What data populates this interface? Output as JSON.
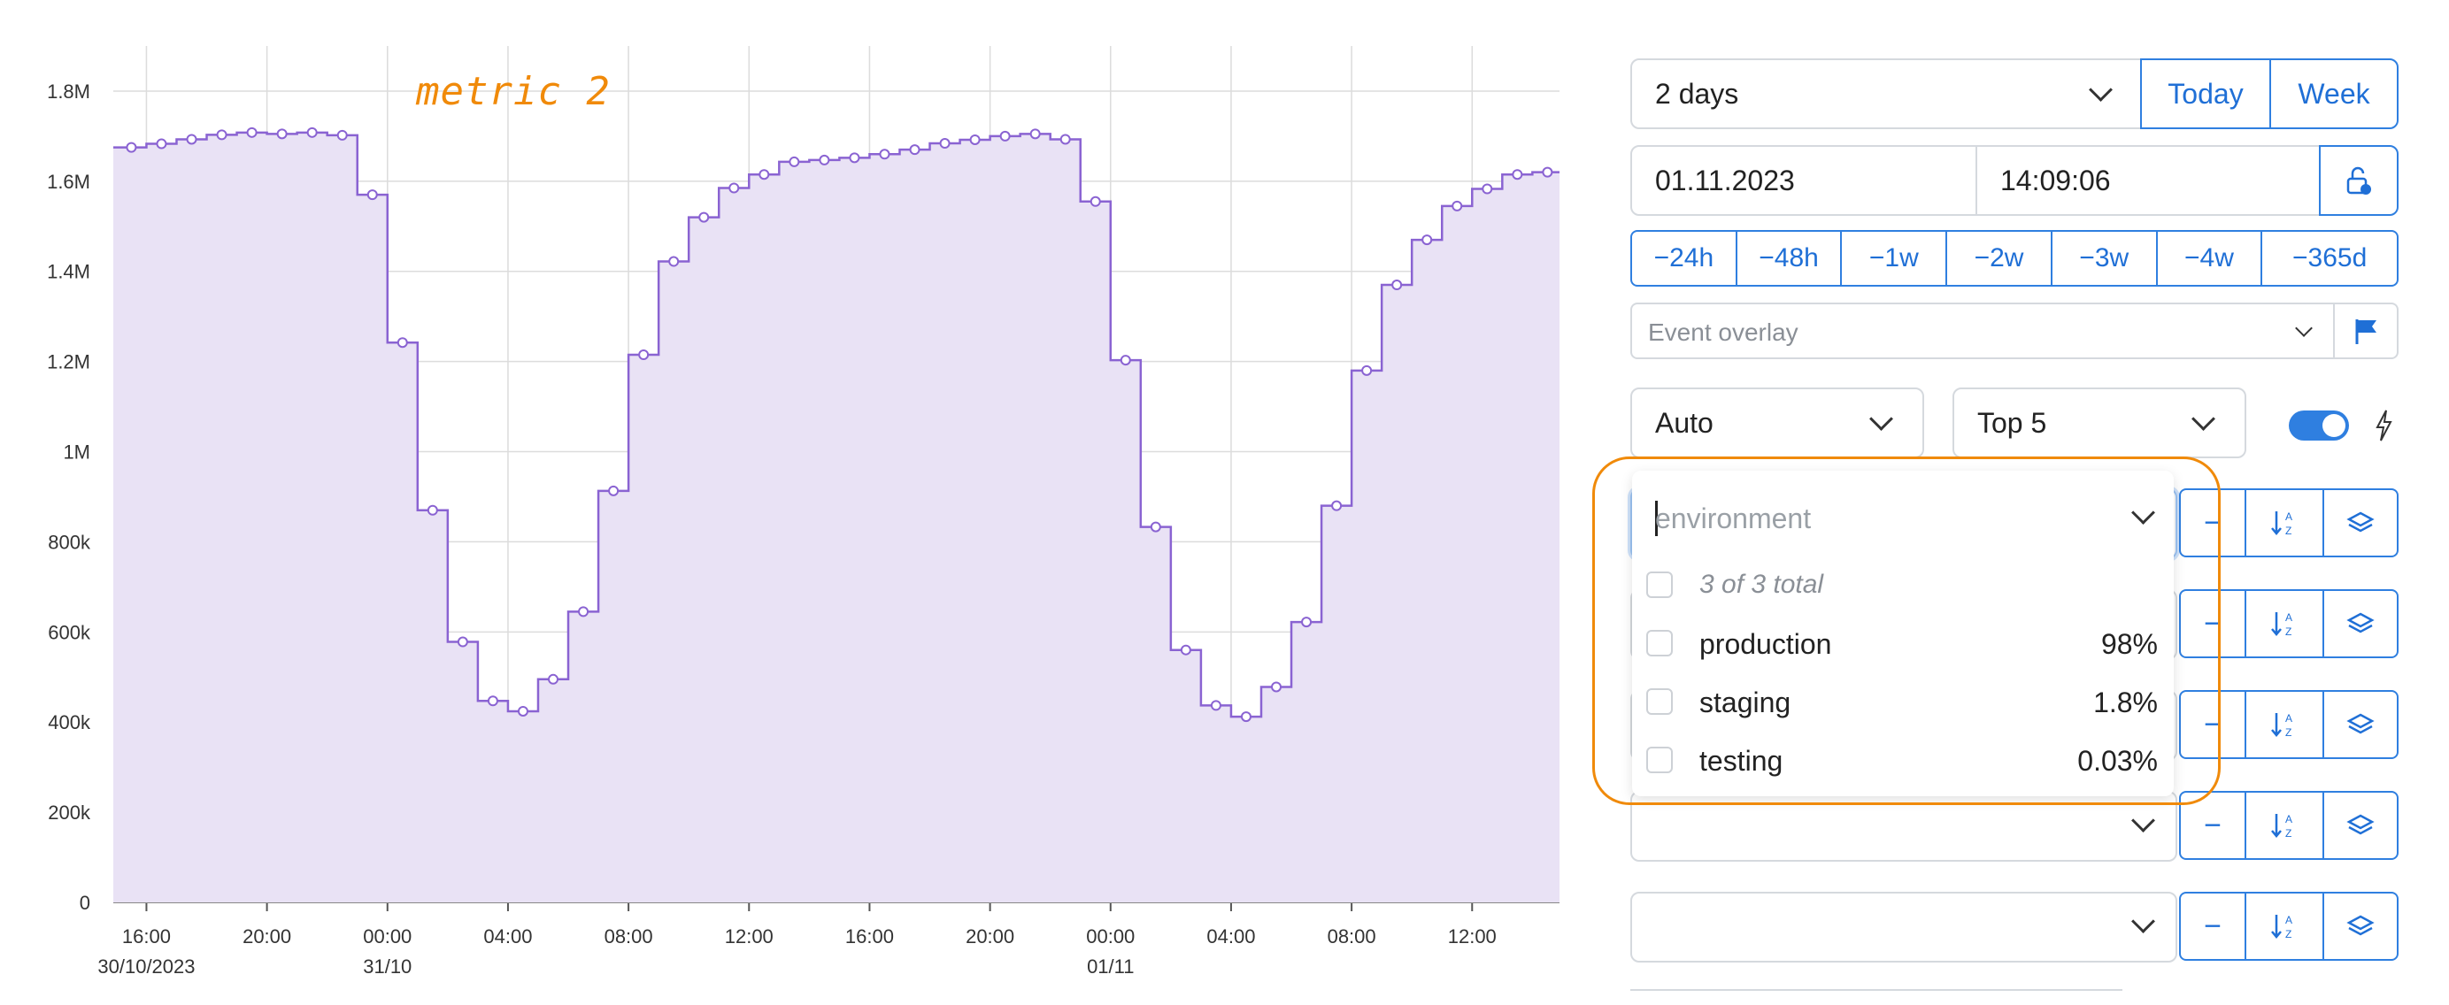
{
  "annotation": "metric 2",
  "controls": {
    "range_select": "2 days",
    "today_label": "Today",
    "week_label": "Week",
    "date_value": "01.11.2023",
    "time_value": "14:09:06",
    "quick_ranges": [
      "−24h",
      "−48h",
      "−1w",
      "−2w",
      "−3w",
      "−4w",
      "−365d"
    ],
    "event_overlay_placeholder": "Event overlay",
    "aggregation_select": "Auto",
    "limit_select": "Top 5",
    "live_toggle_on": true
  },
  "dimension_dropdown": {
    "placeholder": "environment",
    "total_label": "3 of 3 total",
    "options": [
      {
        "label": "production",
        "pct": "98%"
      },
      {
        "label": "staging",
        "pct": "1.8%"
      },
      {
        "label": "testing",
        "pct": "0.03%"
      }
    ],
    "row_button_minus": "−"
  },
  "colors": {
    "accent": "#2f7fe0",
    "series_line": "#8a63d2",
    "series_fill": "#e9e2f5",
    "annotation": "#f08a0a"
  },
  "chart_data": {
    "type": "area",
    "step": true,
    "title": "",
    "ylabel": "",
    "xlabel": "",
    "ylim": [
      0,
      1900000
    ],
    "grid": true,
    "y_ticks": [
      {
        "value": 0,
        "label": "0"
      },
      {
        "value": 200000,
        "label": "200k"
      },
      {
        "value": 400000,
        "label": "400k"
      },
      {
        "value": 600000,
        "label": "600k"
      },
      {
        "value": 800000,
        "label": "800k"
      },
      {
        "value": 1000000,
        "label": "1M"
      },
      {
        "value": 1200000,
        "label": "1.2M"
      },
      {
        "value": 1400000,
        "label": "1.4M"
      },
      {
        "value": 1600000,
        "label": "1.6M"
      },
      {
        "value": 1800000,
        "label": "1.8M"
      }
    ],
    "x_range_hours": [
      -9.1,
      38.9
    ],
    "x_ticks": [
      {
        "hour": -8,
        "label": "16:00",
        "sublabel": "30/10/2023"
      },
      {
        "hour": -4,
        "label": "20:00",
        "sublabel": ""
      },
      {
        "hour": 0,
        "label": "00:00",
        "sublabel": "31/10"
      },
      {
        "hour": 4,
        "label": "04:00",
        "sublabel": ""
      },
      {
        "hour": 8,
        "label": "08:00",
        "sublabel": ""
      },
      {
        "hour": 12,
        "label": "12:00",
        "sublabel": ""
      },
      {
        "hour": 16,
        "label": "16:00",
        "sublabel": ""
      },
      {
        "hour": 20,
        "label": "20:00",
        "sublabel": ""
      },
      {
        "hour": 24,
        "label": "00:00",
        "sublabel": "01/11"
      },
      {
        "hour": 28,
        "label": "04:00",
        "sublabel": ""
      },
      {
        "hour": 32,
        "label": "08:00",
        "sublabel": ""
      },
      {
        "hour": 36,
        "label": "12:00",
        "sublabel": ""
      }
    ],
    "series": [
      {
        "name": "",
        "x_start_hour": -9,
        "step_hours": 1,
        "values": [
          1675000,
          1683000,
          1693000,
          1703000,
          1708000,
          1705000,
          1708000,
          1702000,
          1570000,
          1242000,
          870000,
          578000,
          447000,
          424000,
          495000,
          645000,
          913000,
          1215000,
          1422000,
          1520000,
          1585000,
          1615000,
          1643000,
          1647000,
          1652000,
          1660000,
          1670000,
          1684000,
          1692000,
          1700000,
          1705000,
          1693000,
          1555000,
          1203000,
          833000,
          560000,
          437000,
          412000,
          478000,
          622000,
          880000,
          1180000,
          1370000,
          1470000,
          1545000,
          1583000,
          1615000,
          1620000
        ]
      }
    ]
  }
}
